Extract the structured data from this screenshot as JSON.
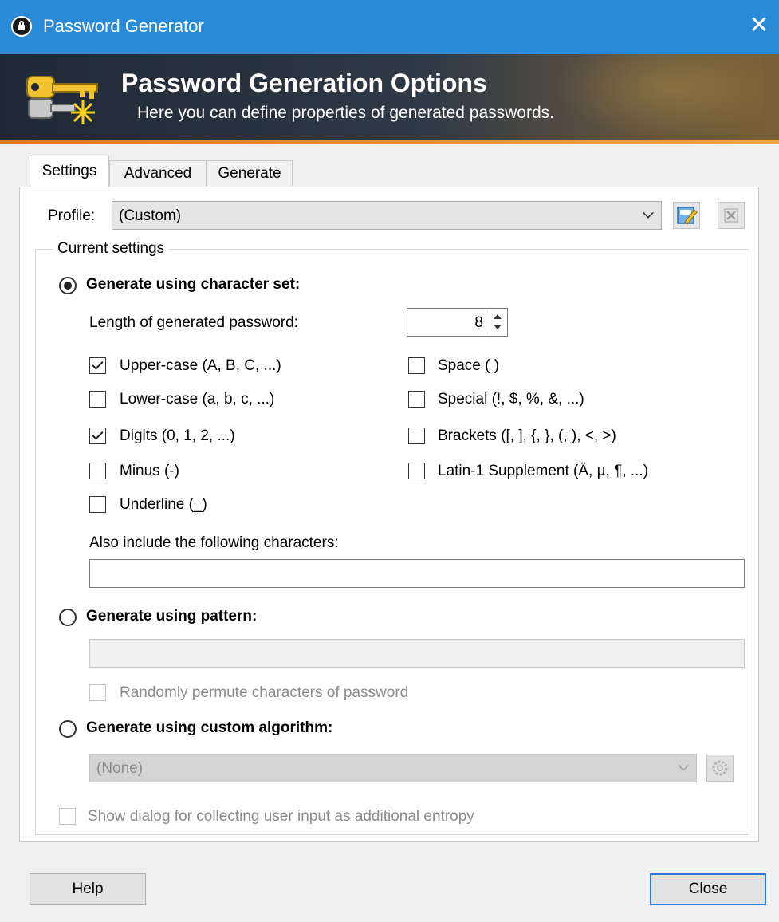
{
  "window": {
    "title": "Password Generator",
    "close_glyph": "✕"
  },
  "banner": {
    "title": "Password Generation Options",
    "subtitle": "Here you can define properties of generated passwords."
  },
  "tabs": [
    {
      "label": "Settings",
      "active": true
    },
    {
      "label": "Advanced",
      "active": false
    },
    {
      "label": "Generate",
      "active": false
    }
  ],
  "profile": {
    "label": "Profile:",
    "value": "(Custom)"
  },
  "current_settings": {
    "label": "Current settings",
    "charset": {
      "label": "Generate using character set:",
      "selected": true,
      "length_label": "Length of generated password:",
      "length_value": "8",
      "options_left": [
        {
          "label": "Upper-case (A, B, C, ...)",
          "checked": true
        },
        {
          "label": "Lower-case (a, b, c, ...)",
          "checked": false
        },
        {
          "label": "Digits (0, 1, 2, ...)",
          "checked": true
        },
        {
          "label": "Minus (-)",
          "checked": false
        },
        {
          "label": "Underline (_)",
          "checked": false
        }
      ],
      "options_right": [
        {
          "label": "Space ( )",
          "checked": false
        },
        {
          "label": "Special (!, $, %, &, ...)",
          "checked": false
        },
        {
          "label": "Brackets ([, ], {, }, (, ), <, >)",
          "checked": false
        },
        {
          "label": "Latin-1 Supplement (Ä, µ, ¶, ...)",
          "checked": false
        }
      ],
      "also_include_label": "Also include the following characters:",
      "also_include_value": ""
    },
    "pattern": {
      "label": "Generate using pattern:",
      "selected": false,
      "value": "",
      "permute_label": "Randomly permute characters of password",
      "permute_checked": false
    },
    "custom": {
      "label": "Generate using custom algorithm:",
      "selected": false,
      "value": "(None)"
    },
    "entropy_label": "Show dialog for collecting user input as additional entropy",
    "entropy_checked": false
  },
  "buttons": {
    "help": "Help",
    "close": "Close"
  },
  "icons": {
    "title": "lock-icon",
    "banner": "keys-icon",
    "profile_save": "save-profile-icon",
    "profile_delete": "delete-profile-icon",
    "custom_options": "gear-icon"
  },
  "colors": {
    "titlebar": "#2b8ad6",
    "banner_accent": "#f2a340",
    "default_button_border": "#2b7ad0"
  }
}
